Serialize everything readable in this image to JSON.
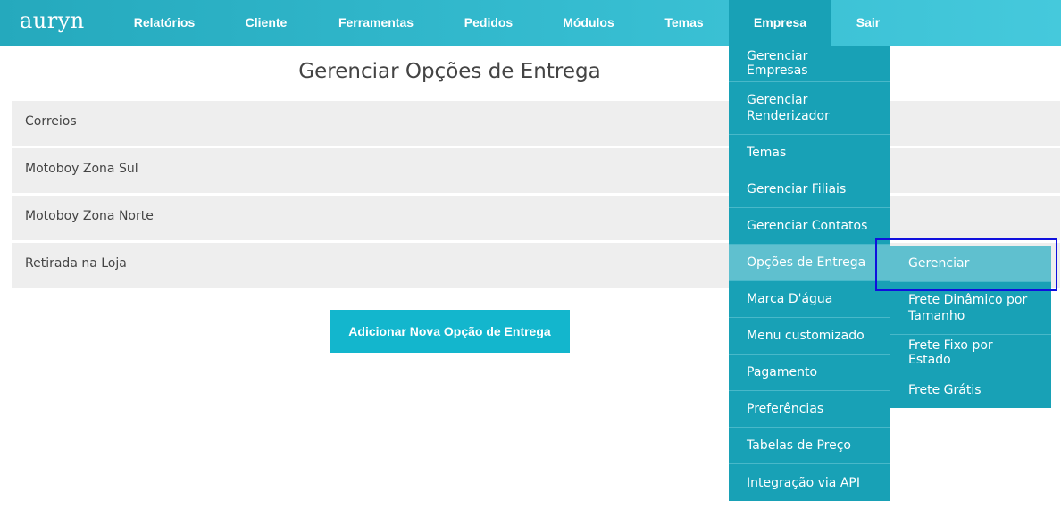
{
  "brand": "auryn",
  "nav": [
    {
      "label": "Relatórios"
    },
    {
      "label": "Cliente"
    },
    {
      "label": "Ferramentas"
    },
    {
      "label": "Pedidos"
    },
    {
      "label": "Módulos"
    },
    {
      "label": "Temas"
    },
    {
      "label": "Empresa",
      "active": true
    },
    {
      "label": "Sair"
    }
  ],
  "page": {
    "title": "Gerenciar Opções de Entrega",
    "options": [
      {
        "label": "Correios"
      },
      {
        "label": "Motoboy Zona Sul"
      },
      {
        "label": "Motoboy Zona Norte"
      },
      {
        "label": "Retirada na Loja"
      }
    ],
    "add_button": "Adicionar Nova Opção de Entrega"
  },
  "dropdown": {
    "items": [
      {
        "label": "Gerenciar Empresas"
      },
      {
        "label": "Gerenciar Renderizador"
      },
      {
        "label": "Temas"
      },
      {
        "label": "Gerenciar Filiais"
      },
      {
        "label": "Gerenciar Contatos"
      },
      {
        "label": "Opções de Entrega",
        "highlighted": true
      },
      {
        "label": "Marca D'água"
      },
      {
        "label": "Menu customizado"
      },
      {
        "label": "Pagamento"
      },
      {
        "label": "Preferências"
      },
      {
        "label": "Tabelas de Preço"
      },
      {
        "label": "Integração via API"
      }
    ],
    "submenu": [
      {
        "label": "Gerenciar",
        "active": true
      },
      {
        "label": "Frete Dinâmico por Tamanho"
      },
      {
        "label": "Frete Fixo por Estado"
      },
      {
        "label": "Frete Grátis"
      }
    ]
  },
  "colors": {
    "topbar": "#35bcd0",
    "menu": "#18a1b6",
    "menu_highlight": "#5fc0cf",
    "button": "#13b6cd",
    "row": "#eeeeee",
    "focus_outline": "#1010dd"
  }
}
